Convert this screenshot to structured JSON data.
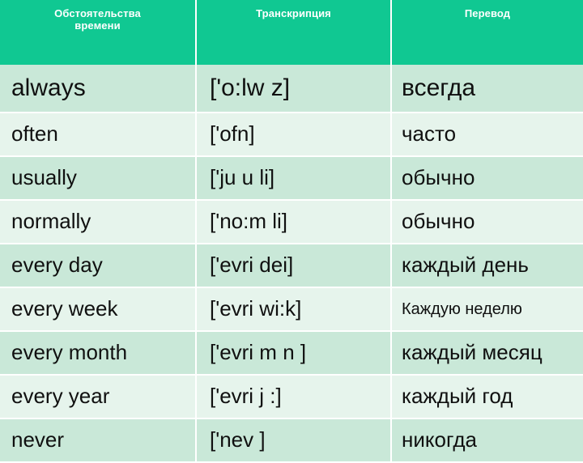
{
  "table": {
    "columns": [
      {
        "key": "term",
        "label": "Обстоятельства\nвремени",
        "label_line1": "Обстоятельства",
        "label_line2": "времени"
      },
      {
        "key": "trans",
        "label": "Транскрипция"
      },
      {
        "key": "ru",
        "label": "Перевод"
      }
    ],
    "header_colors": {
      "background": "#10c892",
      "text": "#ffffff"
    },
    "row_colors": {
      "band_dark": "#c9e8d8",
      "band_light": "#e6f4ec",
      "grid": "#ffffff",
      "text": "#101010"
    },
    "rows": [
      {
        "term": "always",
        "trans": "['o:lw  z]",
        "ru": "всегда"
      },
      {
        "term": "often",
        "trans": "['ofn]",
        "ru": "часто"
      },
      {
        "term": "usually",
        "trans": "['ju   u  li]",
        "ru": "обычно"
      },
      {
        "term": "normally",
        "trans": "['no:m  li]",
        "ru": "обычно"
      },
      {
        "term": "every day",
        "trans": "['evri   dei]",
        "ru": "каждый день"
      },
      {
        "term": "every week",
        "trans": "['evri   wi:k]",
        "ru": "Каждую неделю"
      },
      {
        "term": "every month",
        "trans": "['evri  m n  ]",
        "ru": "каждый месяц"
      },
      {
        "term": "every year",
        "trans": "['evri   j  :]",
        "ru": "каждый год"
      },
      {
        "term": "never",
        "trans": "['nev ]",
        "ru": "никогда"
      }
    ]
  }
}
